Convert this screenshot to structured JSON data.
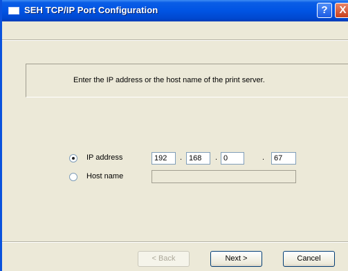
{
  "window": {
    "title": "SEH TCP/IP Port Configuration",
    "help_glyph": "?",
    "close_glyph": "X"
  },
  "instruction": "Enter the IP address or the host name of the print server.",
  "options": {
    "ip_label": "IP address",
    "ip_selected": true,
    "ip_octets": [
      "192",
      "168",
      "0",
      "67"
    ],
    "ip_separator": ".",
    "host_label": "Host name",
    "host_value": ""
  },
  "buttons": {
    "back": "< Back",
    "next": "Next >",
    "cancel": "Cancel"
  }
}
